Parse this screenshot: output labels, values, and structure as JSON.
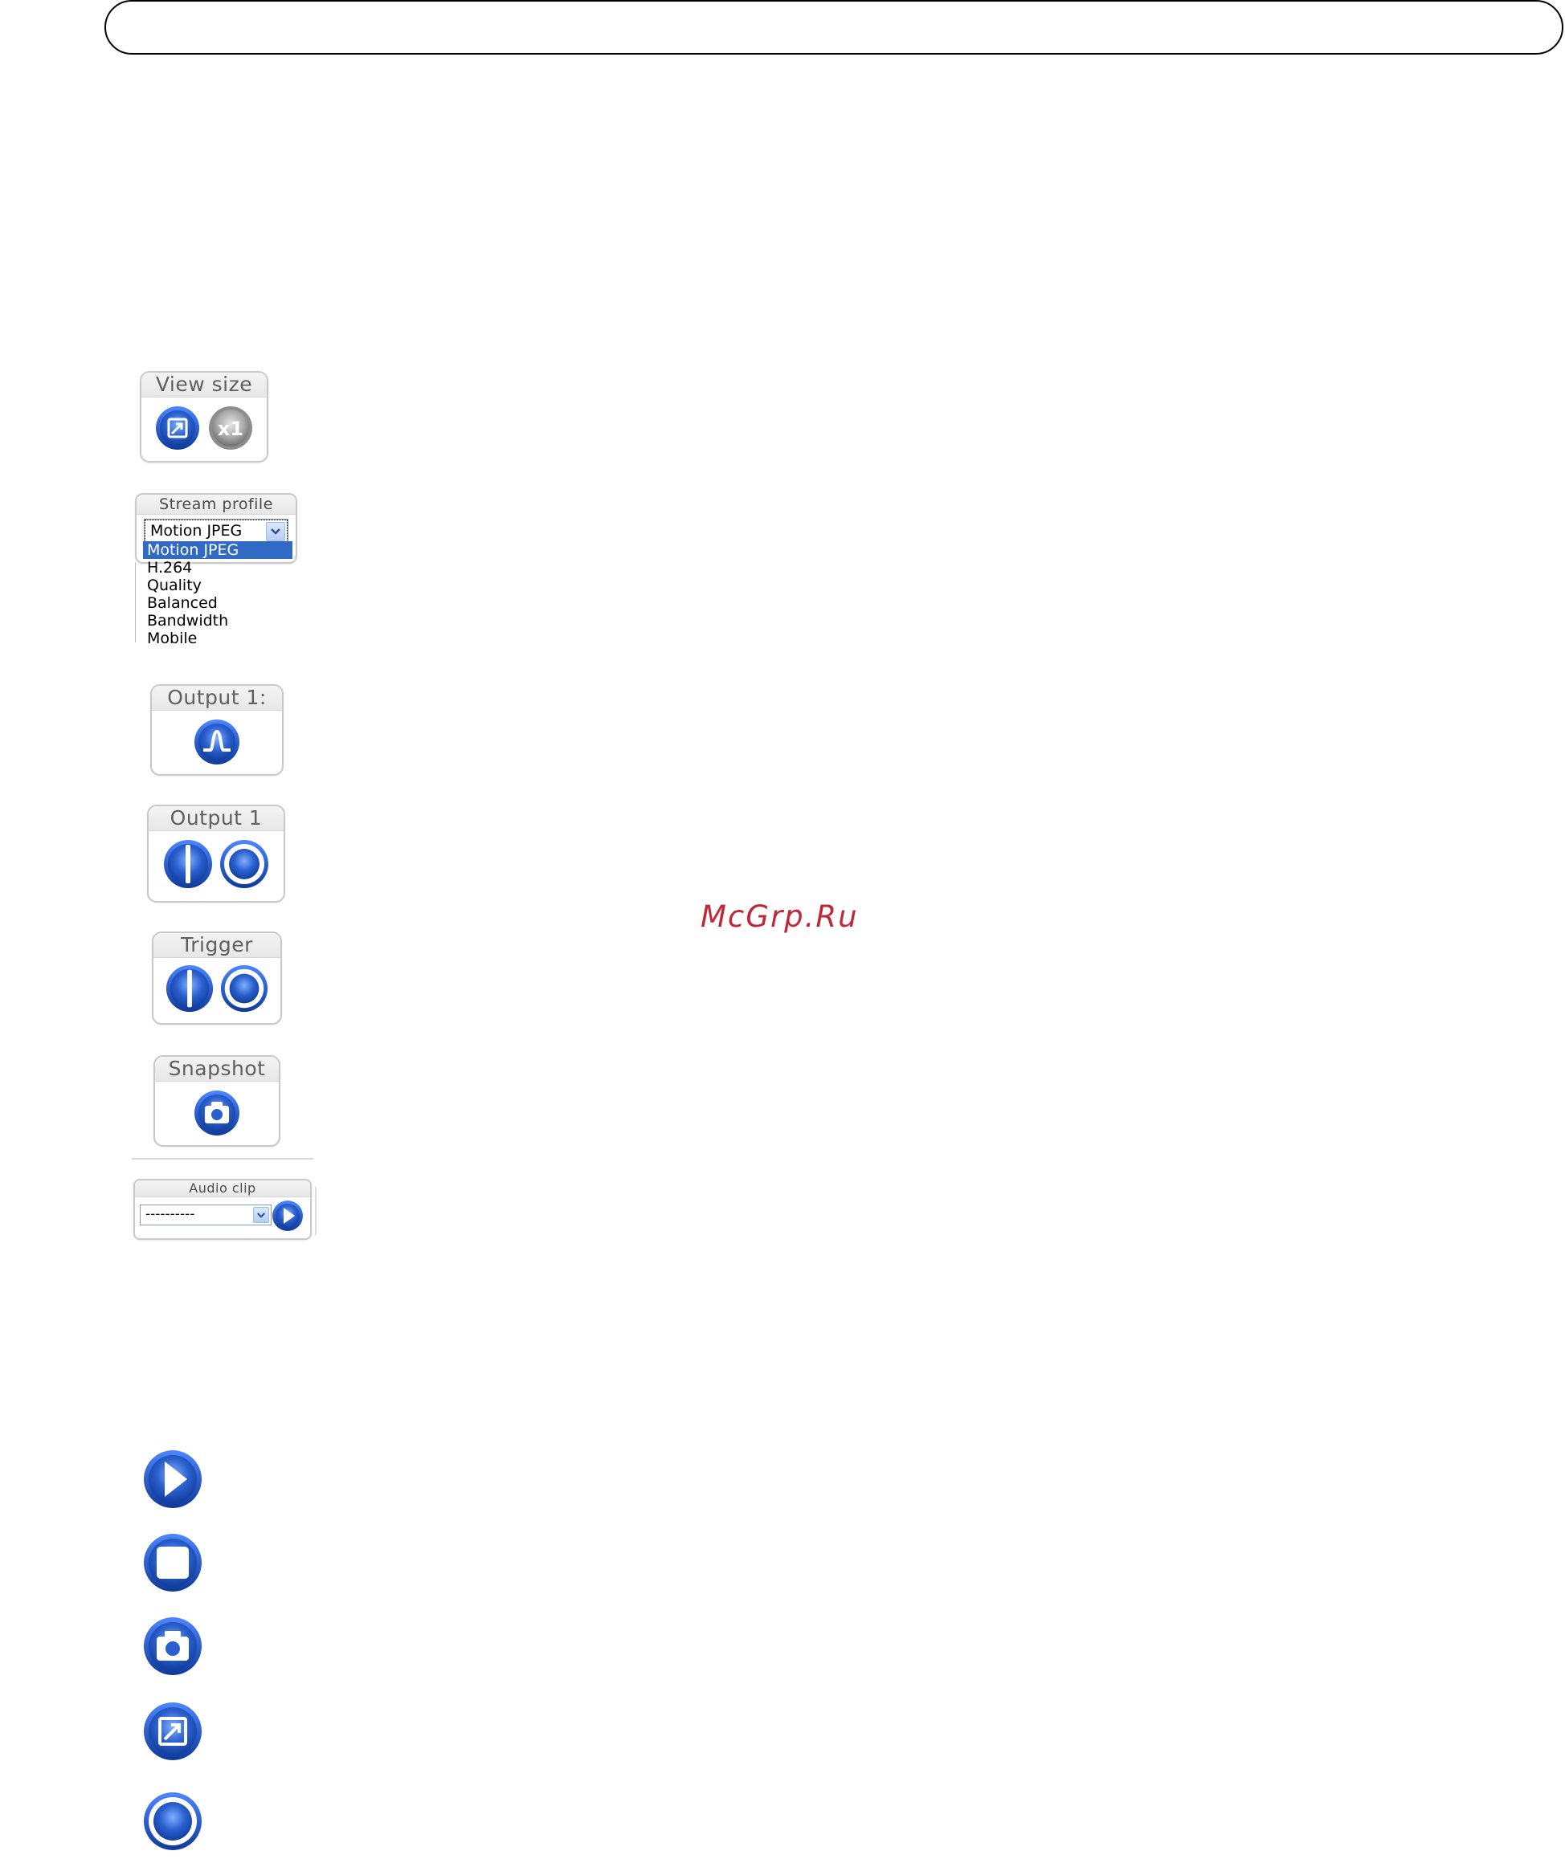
{
  "header": {},
  "view_size": {
    "title": "View size",
    "buttons": [
      {
        "icon": "fullscreen-icon"
      },
      {
        "icon": "x1-icon",
        "label": "x1"
      }
    ]
  },
  "stream_profile": {
    "title": "Stream profile",
    "selected": "Motion JPEG",
    "options": [
      "Motion JPEG",
      "H.264",
      "Quality",
      "Balanced",
      "Bandwidth",
      "Mobile"
    ]
  },
  "output_pulse": {
    "title": "Output 1:",
    "button_icon": "pulse-icon"
  },
  "output_toggle": {
    "title": "Output 1",
    "buttons": [
      "on-icon",
      "off-icon"
    ]
  },
  "trigger": {
    "title": "Trigger",
    "buttons": [
      "on-icon",
      "off-icon"
    ]
  },
  "snapshot": {
    "title": "Snapshot",
    "button_icon": "camera-icon"
  },
  "audio_clip": {
    "title": "Audio clip",
    "selected": "----------",
    "play_icon": "play-icon"
  },
  "watermark": "McGrp.Ru",
  "standalone_icons": [
    "play-icon",
    "stop-icon",
    "camera-icon",
    "fullscreen-icon",
    "record-icon"
  ],
  "colors": {
    "button_blue": "#2b5fcf",
    "button_dark": "#123f9c",
    "watermark": "#c0283a",
    "selected_option": "#316ac5"
  }
}
